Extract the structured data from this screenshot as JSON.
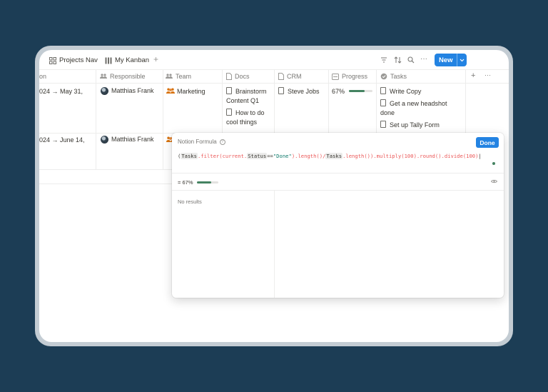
{
  "toolbar": {
    "tabs": [
      {
        "label": "Projects Nav"
      },
      {
        "label": "My Kanban"
      }
    ],
    "add_symbol": "+",
    "more_symbol": "···",
    "new_label": "New",
    "new_dropdown": "⌄"
  },
  "columns": [
    {
      "label": "on"
    },
    {
      "label": "Responsible"
    },
    {
      "label": "Team"
    },
    {
      "label": "Docs"
    },
    {
      "label": "CRM"
    },
    {
      "label": "Progress"
    },
    {
      "label": "Tasks"
    }
  ],
  "header_add_symbol": "+",
  "header_more_symbol": "···",
  "rows": [
    {
      "date": "024 → May 31,",
      "responsible": "Matthias Frank",
      "team": "Marketing",
      "docs": [
        "Brainstorm Content Q1",
        "How to do cool things"
      ],
      "crm": "Steve Jobs",
      "progress_label": "67%",
      "progress_value": 0.67,
      "tasks": [
        "Write Copy",
        "Get a new headshot done",
        "Set up Tally Form"
      ]
    },
    {
      "date": "024 → June 14,",
      "responsible": "Matthias Frank"
    }
  ],
  "formula_popup": {
    "title": "Notion Formula",
    "help_symbol": "?",
    "done_label": "Done",
    "code": {
      "p1": "(",
      "t1": "Tasks",
      "p2": ".filter(current.",
      "t2": "Status",
      "p3": "==",
      "s1": "\"Done\"",
      "p4": ").length()/",
      "t3": "Tasks",
      "p5": ".length()).multiply(100).round().divide(100)"
    },
    "result_prefix": "=",
    "result_label": "67%",
    "result_value": 0.67,
    "no_results": "No results"
  },
  "colors": {
    "accent": "#2383e2",
    "progress": "#448361",
    "background": "#1c3d55"
  }
}
